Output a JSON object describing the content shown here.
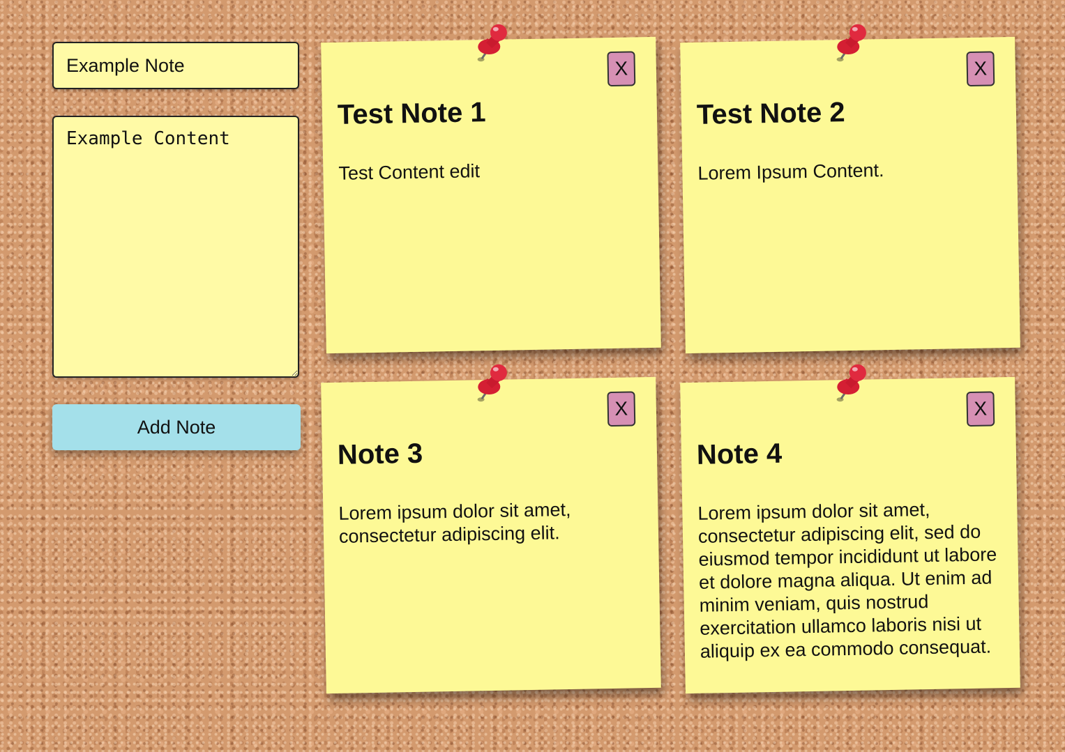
{
  "form": {
    "title_value": "Example Note",
    "content_value": "Example Content",
    "add_button_label": "Add Note"
  },
  "notes": [
    {
      "title": "Test Note 1",
      "content": "Test Content edit",
      "delete_label": "X"
    },
    {
      "title": "Test Note 2",
      "content": "Lorem Ipsum Content.",
      "delete_label": "X"
    },
    {
      "title": "Note 3",
      "content": "Lorem ipsum dolor sit amet, consectetur adipiscing elit.",
      "delete_label": "X"
    },
    {
      "title": "Note 4",
      "content": "Lorem ipsum dolor sit amet, consectetur adipiscing elit, sed do eiusmod tempor incididunt ut labore et dolore magna aliqua. Ut enim ad minim veniam, quis nostrud exercitation ullamco laboris nisi ut aliquip ex ea commodo consequat.",
      "delete_label": "X"
    }
  ],
  "icons": {
    "pin": "pushpin-icon"
  },
  "colors": {
    "note_background": "#fdf996",
    "input_background": "#fffaa6",
    "add_button": "#a4e0ea",
    "delete_button": "#d690b4",
    "pin": "#d41f33",
    "cork": "#d39a6e"
  }
}
